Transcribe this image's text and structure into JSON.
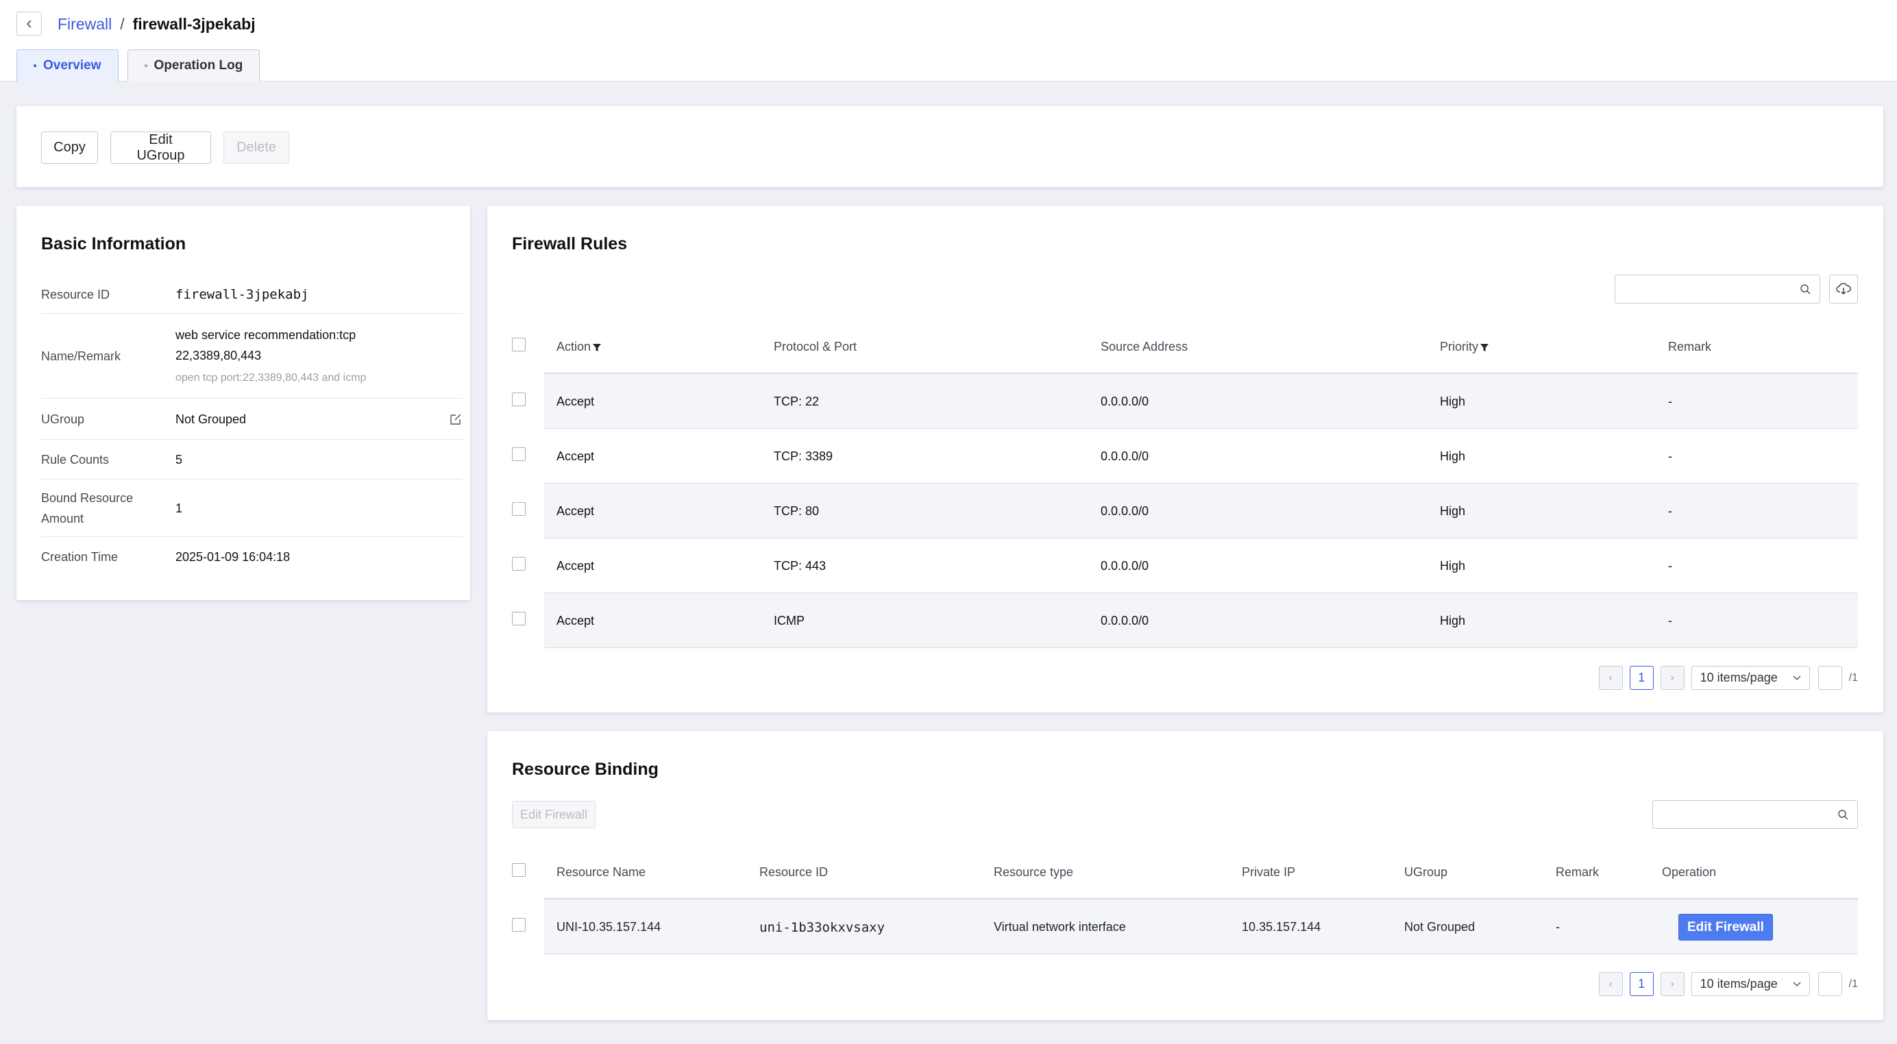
{
  "header": {
    "breadcrumb_parent": "Firewall",
    "breadcrumb_sep": "/",
    "breadcrumb_current": "firewall-3jpekabj",
    "tabs": [
      {
        "label": "Overview",
        "active": true
      },
      {
        "label": "Operation Log",
        "active": false
      }
    ]
  },
  "actions": {
    "copy": "Copy",
    "edit_ugroup": "Edit UGroup",
    "delete": "Delete"
  },
  "basic_info": {
    "title": "Basic Information",
    "resource_id_label": "Resource ID",
    "resource_id": "firewall-3jpekabj",
    "name_label": "Name/Remark",
    "name_line1": "web service recommendation:tcp",
    "name_line2": "22,3389,80,443",
    "remark": "open tcp port:22,3389,80,443 and icmp",
    "ugroup_label": "UGroup",
    "ugroup": "Not Grouped",
    "rule_counts_label": "Rule Counts",
    "rule_counts": "5",
    "bound_label_1": "Bound Resource",
    "bound_label_2": "Amount",
    "bound_amount": "1",
    "creation_label": "Creation Time",
    "creation_time": "2025-01-09 16:04:18"
  },
  "rules": {
    "title": "Firewall Rules",
    "columns": [
      "Action",
      "Protocol & Port",
      "Source Address",
      "Priority",
      "Remark"
    ],
    "rows": [
      {
        "action": "Accept",
        "protocol": "TCP: 22",
        "source": "0.0.0.0/0",
        "priority": "High",
        "remark": "-"
      },
      {
        "action": "Accept",
        "protocol": "TCP: 3389",
        "source": "0.0.0.0/0",
        "priority": "High",
        "remark": "-"
      },
      {
        "action": "Accept",
        "protocol": "TCP: 80",
        "source": "0.0.0.0/0",
        "priority": "High",
        "remark": "-"
      },
      {
        "action": "Accept",
        "protocol": "TCP: 443",
        "source": "0.0.0.0/0",
        "priority": "High",
        "remark": "-"
      },
      {
        "action": "Accept",
        "protocol": "ICMP",
        "source": "0.0.0.0/0",
        "priority": "High",
        "remark": "-"
      }
    ],
    "pager": {
      "page": "1",
      "size": "10 items/page",
      "total": "/1"
    }
  },
  "binding": {
    "title": "Resource Binding",
    "edit_firewall_disabled": "Edit Firewall",
    "columns": [
      "Resource Name",
      "Resource ID",
      "Resource type",
      "Private IP",
      "UGroup",
      "Remark",
      "Operation"
    ],
    "rows": [
      {
        "name": "UNI-10.35.157.144",
        "id": "uni-1b33okxvsaxy",
        "type": "Virtual network interface",
        "ip": "10.35.157.144",
        "ugroup": "Not Grouped",
        "remark": "-",
        "operation": "Edit Firewall"
      }
    ],
    "pager": {
      "page": "1",
      "size": "10 items/page",
      "total": "/1"
    }
  },
  "colors": {
    "accent": "#3b5bdb",
    "primary_button": "#4e7cf0",
    "background": "#eef0f6"
  }
}
